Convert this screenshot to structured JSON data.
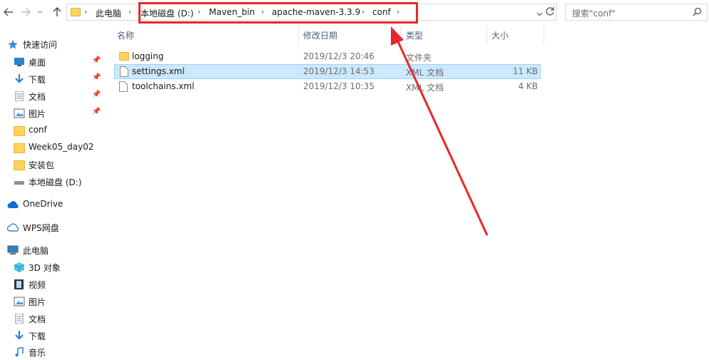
{
  "colors": {
    "accent": "#e8262b",
    "selection": "#cce8ff",
    "header_text": "#4c607a"
  },
  "address": {
    "segments": [
      "此电脑",
      "本地磁盘 (D:)",
      "Maven_bin",
      "apache-maven-3.3.9",
      "conf"
    ]
  },
  "search": {
    "placeholder": "搜索\"conf\""
  },
  "sidebar": {
    "items": [
      {
        "label": "快速访问",
        "icon": "star-icon"
      },
      {
        "label": "桌面",
        "icon": "desktop-icon"
      },
      {
        "label": "下载",
        "icon": "download-icon"
      },
      {
        "label": "文档",
        "icon": "document-icon"
      },
      {
        "label": "图片",
        "icon": "picture-icon"
      },
      {
        "label": "conf",
        "icon": "folder-icon"
      },
      {
        "label": "Week05_day02",
        "icon": "folder-icon"
      },
      {
        "label": "安装包",
        "icon": "folder-icon"
      },
      {
        "label": "本地磁盘 (D:)",
        "icon": "drive-icon"
      },
      {
        "label": "OneDrive",
        "icon": "cloud-icon"
      },
      {
        "label": "WPS网盘",
        "icon": "wps-cloud-icon"
      },
      {
        "label": "此电脑",
        "icon": "computer-icon"
      },
      {
        "label": "3D 对象",
        "icon": "cube-icon"
      },
      {
        "label": "视频",
        "icon": "video-icon"
      },
      {
        "label": "图片",
        "icon": "picture-icon"
      },
      {
        "label": "文档",
        "icon": "document-icon"
      },
      {
        "label": "下载",
        "icon": "download-icon"
      },
      {
        "label": "音乐",
        "icon": "music-icon"
      }
    ]
  },
  "columns": {
    "name": "名称",
    "date": "修改日期",
    "type": "类型",
    "size": "大小"
  },
  "files": [
    {
      "name": "logging",
      "date": "2019/12/3 20:46",
      "type": "文件夹",
      "size": ""
    },
    {
      "name": "settings.xml",
      "date": "2019/12/3 14:53",
      "type": "XML 文档",
      "size": "11 KB"
    },
    {
      "name": "toolchains.xml",
      "date": "2019/12/3 10:35",
      "type": "XML 文档",
      "size": "4 KB"
    }
  ]
}
